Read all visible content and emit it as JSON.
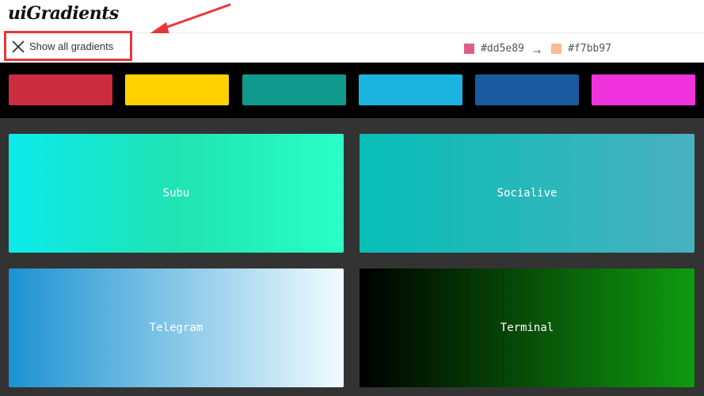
{
  "header": {
    "logo": "uiGradients"
  },
  "toolbar": {
    "show_all_label": "Show all gradients",
    "color_from": "#dd5e89",
    "color_to": "#f7bb97",
    "arrow": "→"
  },
  "filters": [
    {
      "name": "red",
      "color": "#cb2d3e"
    },
    {
      "name": "yellow",
      "color": "#ffd200"
    },
    {
      "name": "green",
      "color": "#11998e"
    },
    {
      "name": "light-blue",
      "color": "#1cb5e0"
    },
    {
      "name": "blue",
      "color": "#1a5a9f"
    },
    {
      "name": "pink",
      "color": "#f133de"
    }
  ],
  "gradients": [
    {
      "name": "Subu",
      "from": "#0cebeb",
      "mid": "#20e3b2",
      "to": "#29ffc6"
    },
    {
      "name": "Socialive",
      "from": "#06beb6",
      "to": "#48b1bf"
    },
    {
      "name": "Telegram",
      "from": "#1c92d2",
      "to": "#f2fcfe"
    },
    {
      "name": "Terminal",
      "from": "#000000",
      "to": "#0f9b0f"
    }
  ],
  "annotation_color": "#e8363a"
}
